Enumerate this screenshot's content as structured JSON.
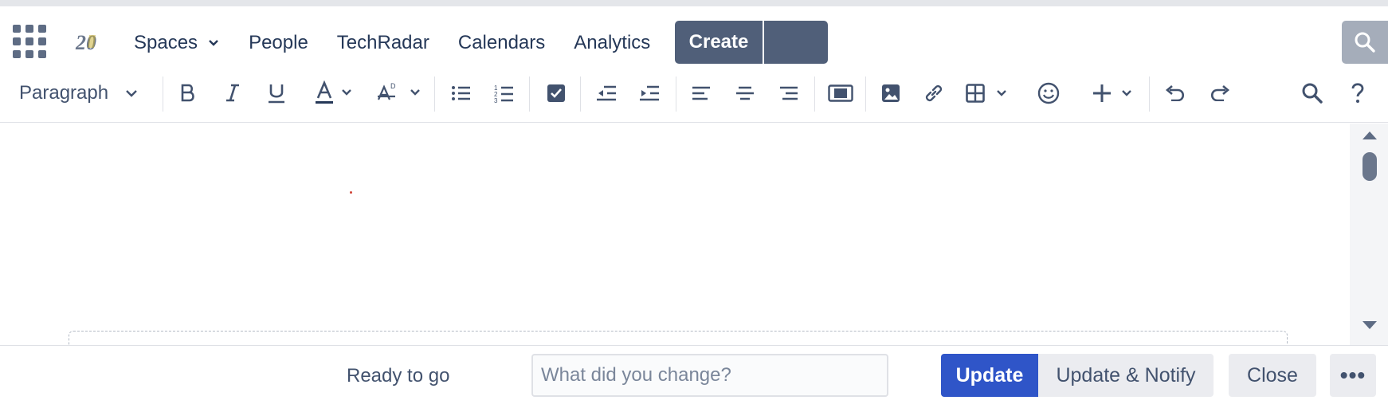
{
  "header": {
    "logo_text": "20",
    "nav": [
      {
        "label": "Spaces"
      },
      {
        "label": "People"
      },
      {
        "label": "TechRadar"
      },
      {
        "label": "Calendars"
      },
      {
        "label": "Analytics"
      }
    ],
    "create_label": "Create",
    "accent": "#505f79"
  },
  "toolbar": {
    "paragraph_style": "Paragraph",
    "icons": [
      "bold-icon",
      "italic-icon",
      "underline-icon",
      "text-color-icon",
      "text-format-icon",
      "bullet-list-icon",
      "numbered-list-icon",
      "task-list-icon",
      "outdent-icon",
      "indent-icon",
      "align-left-icon",
      "align-center-icon",
      "align-right-icon",
      "page-layout-icon",
      "image-icon",
      "link-icon",
      "table-icon",
      "emoji-icon",
      "insert-more-icon",
      "undo-icon",
      "redo-icon",
      "find-replace-icon",
      "help-icon"
    ],
    "text_color": "#253858"
  },
  "footer": {
    "status": "Ready to go",
    "comment_placeholder": "What did you change?",
    "comment_value": "",
    "update_label": "Update",
    "update_notify_label": "Update & Notify",
    "close_label": "Close",
    "more_label": "•••",
    "primary_color": "#2f55c8"
  }
}
